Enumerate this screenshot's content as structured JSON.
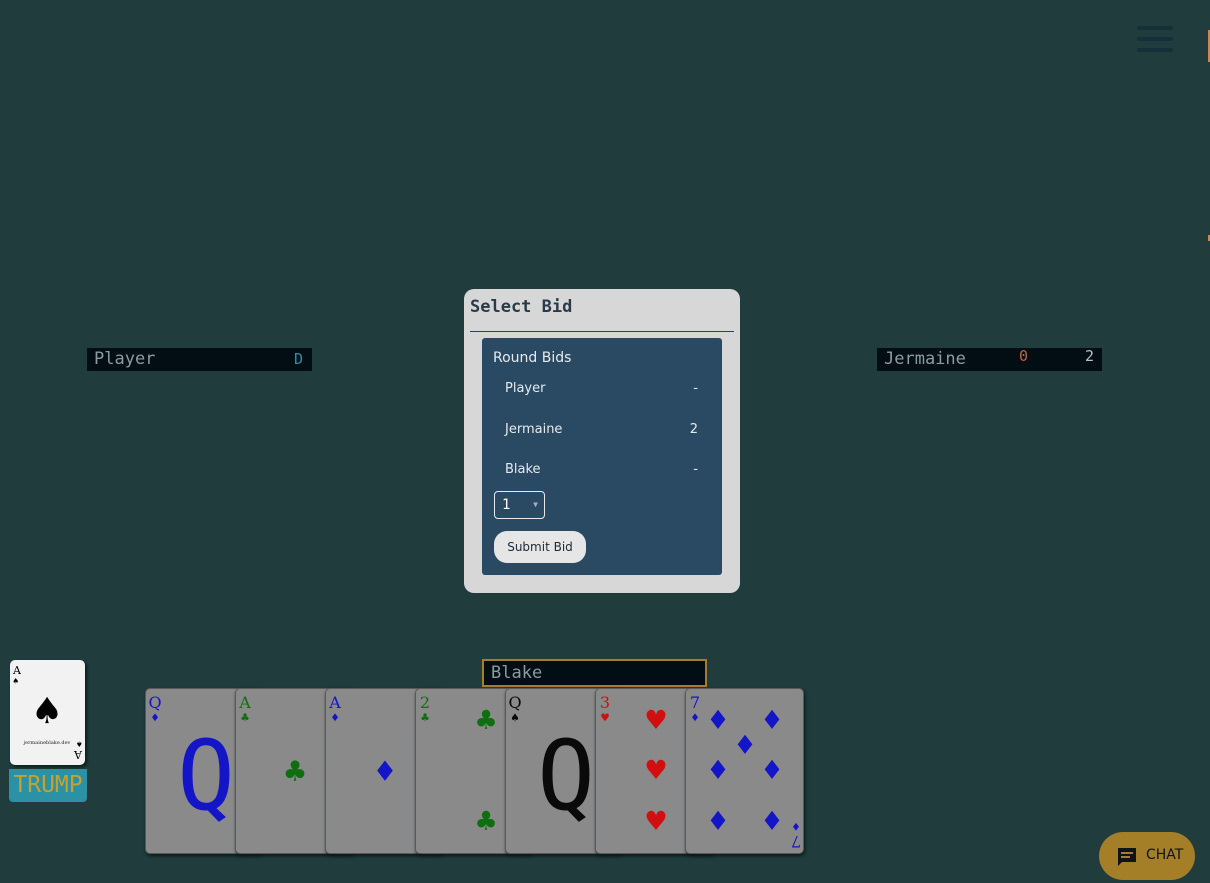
{
  "menu": {
    "icon": "hamburger-menu-icon"
  },
  "players": {
    "left": {
      "name": "Player",
      "dealer_tag": "D"
    },
    "right": {
      "name": "Jermaine",
      "tricks": "0",
      "bid": "2"
    },
    "bottom": {
      "name": "Blake"
    }
  },
  "modal": {
    "title": "Select Bid",
    "bids_title": "Round Bids",
    "bids": [
      {
        "name": "Player",
        "value": "-"
      },
      {
        "name": "Jermaine",
        "value": "2"
      },
      {
        "name": "Blake",
        "value": "-"
      }
    ],
    "selected_bid": "1",
    "submit_label": "Submit Bid"
  },
  "trump": {
    "label": "TRUMP",
    "card": {
      "rank": "A",
      "suit": "spades",
      "watermark": "jermaineblake.dev"
    }
  },
  "hand": [
    {
      "rank": "Q",
      "suit": "diamonds"
    },
    {
      "rank": "A",
      "suit": "clubs"
    },
    {
      "rank": "A",
      "suit": "diamonds"
    },
    {
      "rank": "2",
      "suit": "clubs"
    },
    {
      "rank": "Q",
      "suit": "spades"
    },
    {
      "rank": "3",
      "suit": "hearts"
    },
    {
      "rank": "7",
      "suit": "diamonds"
    }
  ],
  "colors": {
    "diamonds": "#1414c8",
    "clubs": "#0f6e0f",
    "hearts": "#d01010",
    "spades": "#0a0a0a"
  },
  "chat": {
    "label": "CHAT",
    "icon": "chat-icon"
  }
}
